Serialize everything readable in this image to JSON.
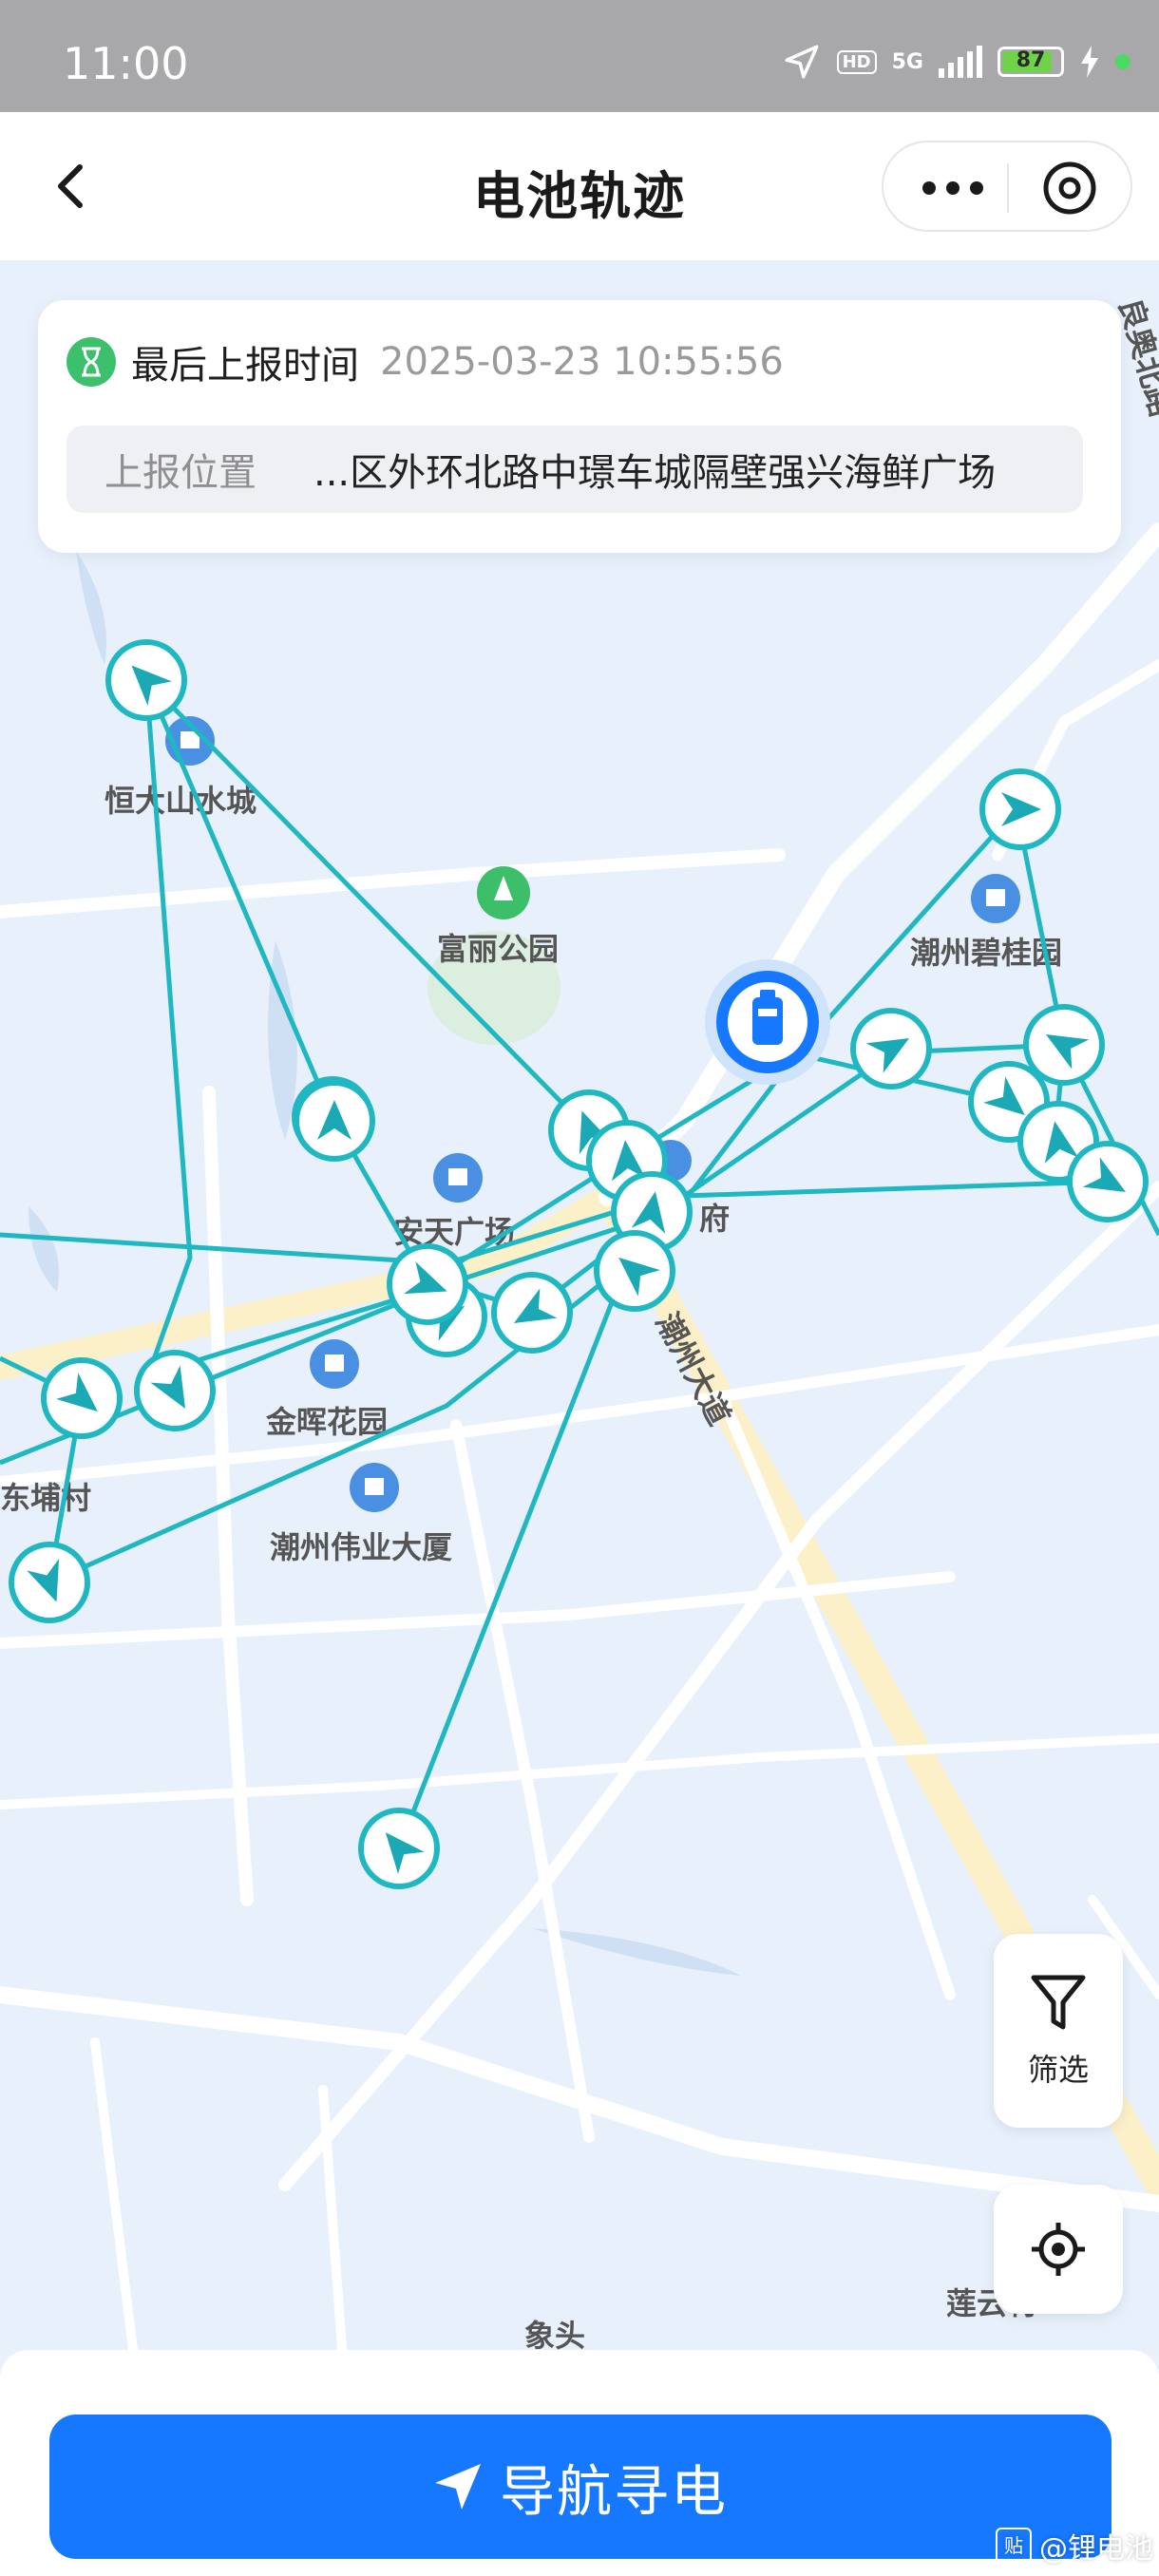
{
  "status_bar": {
    "time": "11:00",
    "network": "5G",
    "hd": "HD",
    "battery": "87",
    "battery_level": 0.87
  },
  "nav": {
    "title": "电池轨迹"
  },
  "info": {
    "last_report_label": "最后上报时间",
    "last_report_time": "2025-03-23 10:55:56",
    "location_label": "上报位置",
    "location_value": "...区外环北路中璟车城隔壁强兴海鲜广场"
  },
  "map": {
    "pois": [
      "恒大山水城",
      "富丽公园",
      "潮州碧桂园",
      "安天广场",
      "府",
      "金晖花园",
      "潮州伟业大厦",
      "东埔村",
      "象头",
      "莲云村"
    ],
    "roads": [
      "潮州大道",
      "良奥北路"
    ],
    "track_color": "#1fb8c2",
    "marker_color": "#1aa9b5"
  },
  "controls": {
    "filter_label": "筛选"
  },
  "bottom": {
    "nav_button_label": "导航寻电"
  },
  "watermark": {
    "text": "@锂电池"
  }
}
